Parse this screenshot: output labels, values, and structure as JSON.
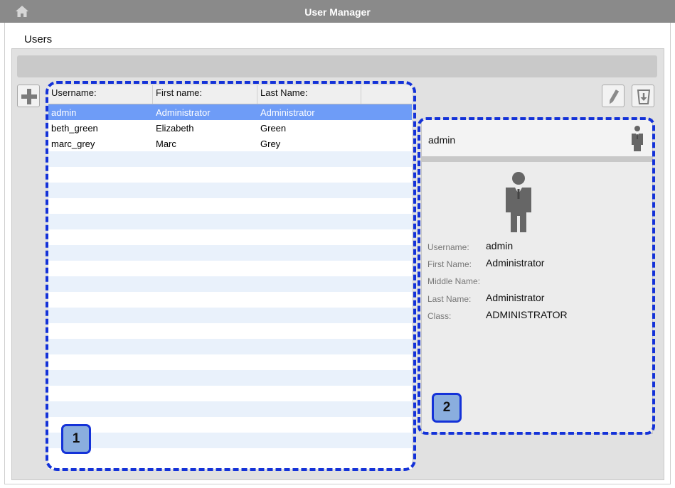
{
  "window": {
    "title": "User Manager",
    "home_icon": "home-icon"
  },
  "section_title": "Users",
  "toolbar": {
    "add_icon": "plus-icon",
    "edit_icon": "pencil-icon",
    "delete_icon": "trash-icon"
  },
  "table": {
    "columns": [
      "Username:",
      "First name:",
      "Last Name:"
    ],
    "rows": [
      {
        "username": "admin",
        "first": "Administrator",
        "last": "Administrator",
        "selected": true
      },
      {
        "username": "beth_green",
        "first": "Elizabeth",
        "last": "Green",
        "selected": false
      },
      {
        "username": "marc_grey",
        "first": "Marc",
        "last": "Grey",
        "selected": false
      }
    ],
    "selected_color": "#6e9cf7",
    "stripe_color": "#e9f1fb"
  },
  "details": {
    "header_name": "admin",
    "avatar_icon": "person-icon",
    "fields": [
      {
        "label": "Username:",
        "value": "admin"
      },
      {
        "label": "First Name:",
        "value": "Administrator"
      },
      {
        "label": "Middle Name:",
        "value": ""
      },
      {
        "label": "Last Name:",
        "value": "Administrator"
      },
      {
        "label": "Class:",
        "value": "ADMINISTRATOR"
      }
    ]
  },
  "annotations": {
    "callout_1": "1",
    "callout_2": "2",
    "color": "#1432d8"
  }
}
